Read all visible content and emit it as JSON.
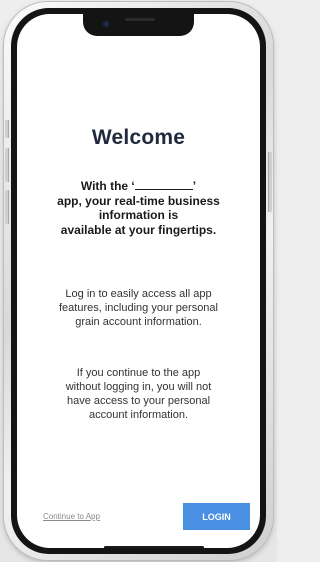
{
  "welcome": {
    "title": "Welcome",
    "intro_lines": {
      "line1_before": "With the ‘",
      "line1_after": "’",
      "line2": "app, your real-time business",
      "line3": "information is",
      "line4": "available at your fingertips."
    },
    "login_note_lines": [
      "Log in to easily access all app",
      "features, including your personal",
      "grain account information."
    ],
    "continue_note_lines": [
      "If you continue to the app",
      "without logging in, you will not",
      "have access to your personal",
      "account information."
    ]
  },
  "actions": {
    "continue_label": "Continue to App",
    "login_label": "LOGIN"
  },
  "colors": {
    "accent": "#4a90e2",
    "title": "#1f2a3d"
  }
}
